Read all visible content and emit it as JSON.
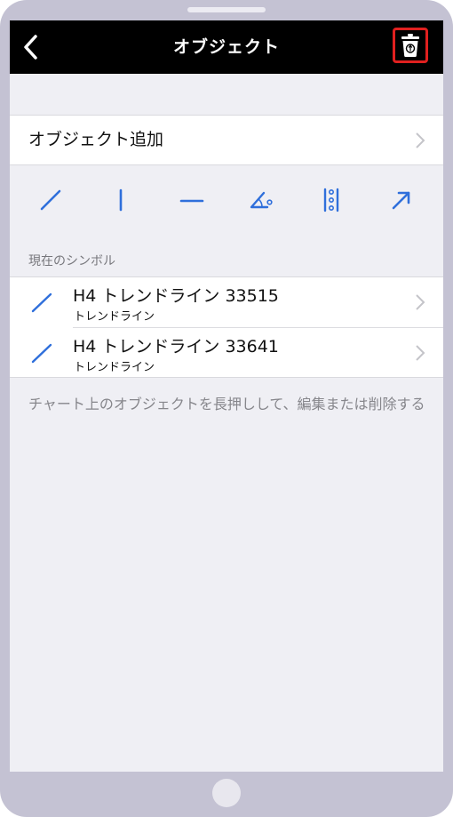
{
  "navbar": {
    "title": "オブジェクト",
    "back_icon": "chevron-left-icon",
    "trash_icon": "trash-icon",
    "trash_highlight_color": "#e0201f"
  },
  "add_object": {
    "label": "オブジェクト追加"
  },
  "tools": [
    {
      "name": "trendline-tool",
      "icon": "diagonal-line-icon"
    },
    {
      "name": "vertical-line-tool",
      "icon": "vertical-line-icon"
    },
    {
      "name": "horizontal-line-tool",
      "icon": "horizontal-line-icon"
    },
    {
      "name": "angle-tool",
      "icon": "angle-icon"
    },
    {
      "name": "fibonacci-tool",
      "icon": "fibonacci-icon"
    },
    {
      "name": "arrow-tool",
      "icon": "arrow-icon"
    }
  ],
  "accent_color": "#2f6fdb",
  "current_symbols": {
    "header": "現在のシンボル",
    "items": [
      {
        "title": "H4 トレンドライン 33515",
        "subtitle": "トレンドライン"
      },
      {
        "title": "H4 トレンドライン 33641",
        "subtitle": "トレンドライン"
      }
    ]
  },
  "hint": "チャート上のオブジェクトを長押しして、編集または削除する"
}
